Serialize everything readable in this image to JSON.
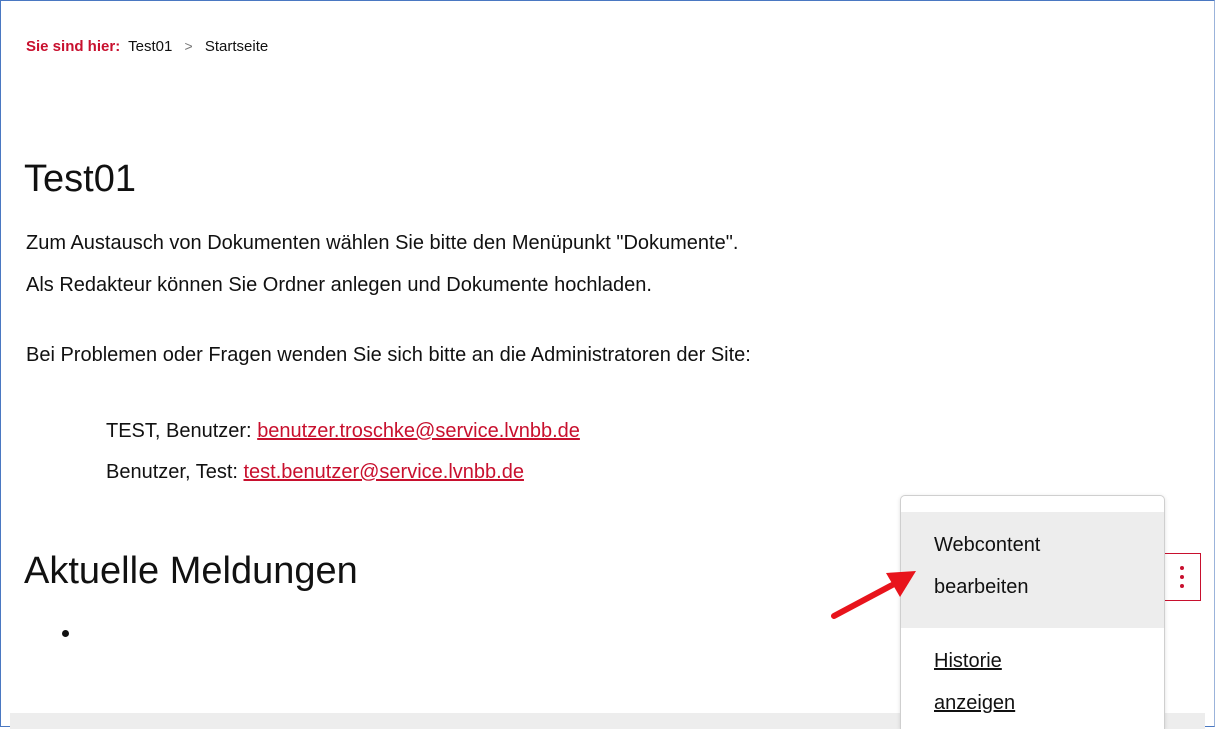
{
  "breadcrumb": {
    "label": "Sie sind hier:",
    "items": [
      "Test01",
      "Startseite"
    ],
    "separator": ">"
  },
  "page": {
    "title": "Test01",
    "paragraphs": [
      "Zum Austausch von Dokumenten wählen Sie bitte den Menüpunkt \"Dokumente\".",
      "Als Redakteur können Sie Ordner anlegen und Dokumente hochladen.",
      "Bei Problemen oder Fragen wenden Sie sich bitte an die Administratoren der Site:"
    ],
    "contacts": [
      {
        "name": "TEST, Benutzer:",
        "email": "benutzer.troschke@service.lvnbb.de"
      },
      {
        "name": "Benutzer, Test:",
        "email": "test.benutzer@service.lvnbb.de"
      }
    ],
    "section_title": "Aktuelle Meldungen"
  },
  "options_menu": {
    "items": [
      {
        "line1": "Webcontent",
        "line2": "bearbeiten"
      },
      {
        "line1": "Historie",
        "line2": "anzeigen"
      }
    ]
  },
  "icons": {
    "options": "kebab-vertical-icon",
    "annotation": "red-arrow-icon"
  },
  "colors": {
    "accent": "#c8102e",
    "annotation": "#e8141c",
    "menu_hover": "#ededed"
  }
}
